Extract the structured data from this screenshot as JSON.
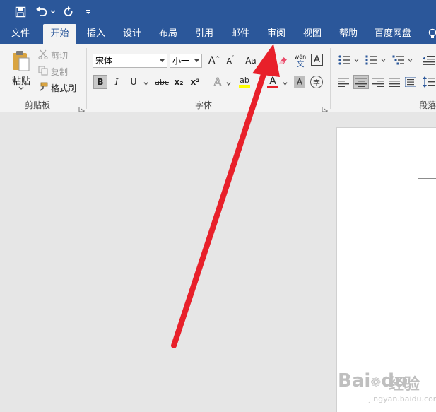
{
  "qat": {
    "save_icon": "save-icon",
    "undo_icon": "undo-icon",
    "redo_icon": "redo-icon",
    "customize_icon": "customize-qat-icon"
  },
  "tabs": [
    {
      "label": "文件"
    },
    {
      "label": "开始"
    },
    {
      "label": "插入"
    },
    {
      "label": "设计"
    },
    {
      "label": "布局"
    },
    {
      "label": "引用"
    },
    {
      "label": "邮件"
    },
    {
      "label": "审阅"
    },
    {
      "label": "视图"
    },
    {
      "label": "帮助"
    },
    {
      "label": "百度网盘"
    }
  ],
  "active_tab": "开始",
  "clipboard": {
    "paste_label": "粘贴",
    "cut_label": "剪切",
    "copy_label": "复制",
    "format_painter_label": "格式刷",
    "group_label": "剪贴板"
  },
  "font": {
    "font_name": "宋体",
    "font_size": "小一",
    "group_label": "字体",
    "bold": "B",
    "italic": "I",
    "underline": "U",
    "strikethrough": "abc",
    "subscript": "x₂",
    "superscript": "x²",
    "change_case": "Aa",
    "phonetic": "wén",
    "phonetic_char": "文",
    "char_border": "A",
    "char_shading": "A",
    "enclose": "字",
    "highlight": "ab",
    "font_color": "A",
    "text_effect": "A",
    "grow": "A",
    "shrink": "A"
  },
  "paragraph": {
    "group_label": "段落"
  },
  "watermark": {
    "brand": "Bai",
    "brand2": "du",
    "sub": "经验",
    "url": "jingyan.baidu.com"
  },
  "colors": {
    "brand_blue": "#2b579a",
    "ribbon_bg": "#f3f3f3",
    "arrow_red": "#e8202a"
  }
}
